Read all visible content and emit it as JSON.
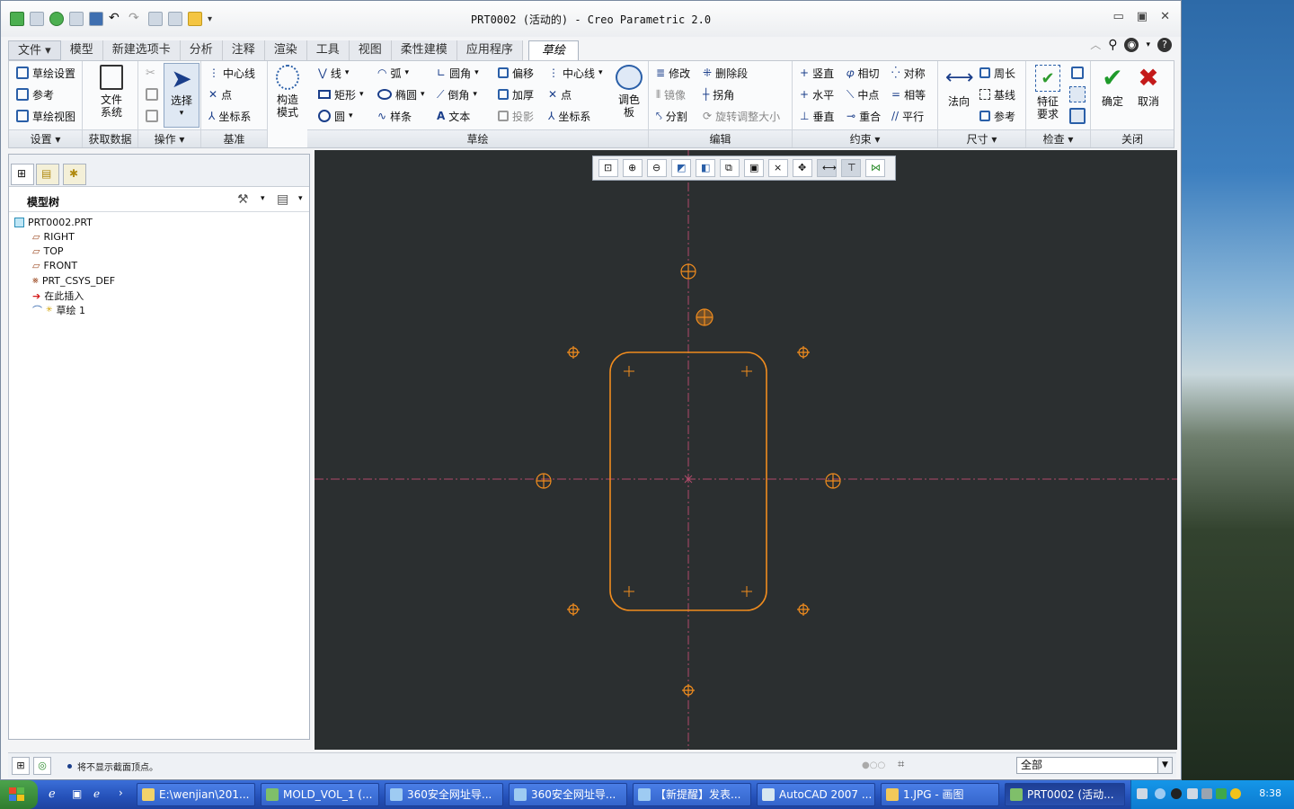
{
  "window": {
    "title": "PRT0002 (活动的) - Creo Parametric 2.0"
  },
  "tabs": [
    {
      "label": "文件",
      "has_arrow": true
    },
    {
      "label": "模型"
    },
    {
      "label": "新建选项卡"
    },
    {
      "label": "分析"
    },
    {
      "label": "注释"
    },
    {
      "label": "渲染"
    },
    {
      "label": "工具"
    },
    {
      "label": "视图"
    },
    {
      "label": "柔性建模"
    },
    {
      "label": "应用程序"
    },
    {
      "label": "草绘",
      "active": true
    }
  ],
  "ribbon": {
    "setup": {
      "label": "设置",
      "items": [
        "草绘设置",
        "参考",
        "草绘视图"
      ]
    },
    "get_data": {
      "label": "获取数据",
      "big": "文件系统"
    },
    "operations": {
      "label": "操作",
      "big": "选择"
    },
    "datum": {
      "label": "基准",
      "items": [
        "中心线",
        "点",
        "坐标系"
      ]
    },
    "construct": {
      "big": "构造模式"
    },
    "sketch": {
      "label": "草绘",
      "col1": [
        "线",
        "矩形",
        "圆"
      ],
      "col2": [
        "弧",
        "椭圆",
        "样条"
      ],
      "col3": [
        "圆角",
        "倒角",
        "文本"
      ],
      "col4": [
        "偏移",
        "加厚",
        "投影"
      ],
      "col5": [
        "中心线",
        "点",
        "坐标系"
      ],
      "palette": "调色板"
    },
    "edit": {
      "label": "编辑",
      "items": [
        "修改",
        "删除段",
        "镜像",
        "拐角",
        "分割",
        "旋转调整大小"
      ]
    },
    "constrain": {
      "label": "约束",
      "items": [
        "竖直",
        "相切",
        "对称",
        "水平",
        "中点",
        "相等",
        "垂直",
        "重合",
        "平行"
      ]
    },
    "dimension": {
      "label": "尺寸",
      "big": "法向",
      "items": [
        "周长",
        "基线",
        "参考"
      ]
    },
    "inspect": {
      "label": "检查",
      "big": "特征要求"
    },
    "close": {
      "label": "关闭",
      "ok": "确定",
      "cancel": "取消"
    }
  },
  "model_tree": {
    "title": "模型树",
    "items": [
      "PRT0002.PRT",
      "RIGHT",
      "TOP",
      "FRONT",
      "PRT_CSYS_DEF",
      "在此插入",
      "草绘 1"
    ]
  },
  "status": {
    "message": "将不显示截面顶点。",
    "filter": "全部"
  },
  "taskbar": {
    "tasks": [
      "E:\\wenjian\\201...",
      "MOLD_VOL_1 (...",
      "360安全网址导...",
      "360安全网址导...",
      "【新提醒】发表...",
      "AutoCAD 2007 ...",
      "1.JPG - 画图",
      "PRT0002 (活动..."
    ],
    "clock": "8:38"
  },
  "colors": {
    "sketch": "#f08c1e",
    "canvas": "#2b2f30",
    "axis": "#b04a6a"
  }
}
